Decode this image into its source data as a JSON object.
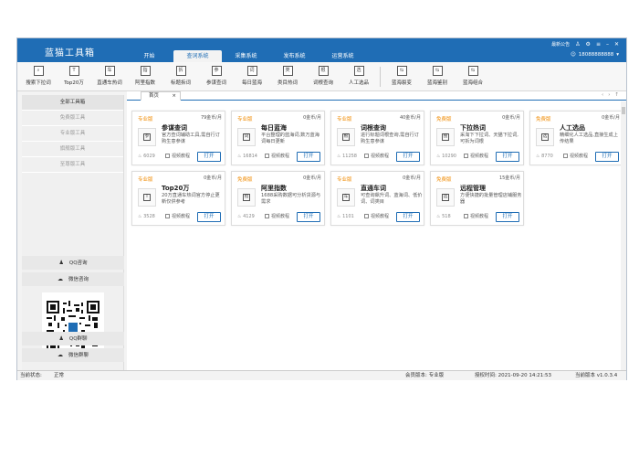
{
  "app": {
    "title": "蓝猫工具箱"
  },
  "nav": {
    "tabs": [
      "开始",
      "查词系统",
      "采集系统",
      "发布系统",
      "运营系统"
    ],
    "active": "查词系统"
  },
  "window": {
    "announcement": "最新公告",
    "user_phone": "18088888888"
  },
  "toolbar": {
    "items": [
      {
        "label": "搜索下拉词",
        "icon": "search-icon"
      },
      {
        "label": "Top20万",
        "icon": "top-icon"
      },
      {
        "label": "直通车热词",
        "icon": "car-icon"
      },
      {
        "label": "阿里指数",
        "icon": "index-icon"
      },
      {
        "label": "标题拆词",
        "icon": "split-icon"
      },
      {
        "label": "参谋查词",
        "icon": "advisor-icon"
      },
      {
        "label": "每日蓝海",
        "icon": "bluesea-icon"
      },
      {
        "label": "类目热词",
        "icon": "category-icon"
      },
      {
        "label": "词根查询",
        "icon": "root-icon"
      },
      {
        "label": "人工选品",
        "icon": "pick-icon"
      },
      {
        "label": "蓝海裂变",
        "icon": "fission-icon"
      },
      {
        "label": "蓝海鉴别",
        "icon": "identify-icon"
      },
      {
        "label": "蓝海组合",
        "icon": "combine-icon"
      }
    ]
  },
  "sidebar": {
    "items": [
      "全部工具箱",
      "免费版工具",
      "专业版工具",
      "旗舰版工具",
      "至尊版工具"
    ],
    "qq_consult": "QQ咨询",
    "wechat_consult": "微信咨询",
    "qq_group": "QQ群聊",
    "wechat_group": "微信群聊"
  },
  "content": {
    "tab_label": "首页",
    "tab_close": "×",
    "tab_nav": {
      "prev": "‹",
      "next": "›",
      "pin": "↑"
    },
    "video_label": "视频教程",
    "open_label": "打开",
    "cards": [
      {
        "tag": "专业版",
        "price": "79金币/月",
        "name": "参谋查词",
        "desc": "官方查词辅助工具,需自行订购生意参谋",
        "heat": "6029",
        "glyph": "参"
      },
      {
        "tag": "专业版",
        "price": "0金币/月",
        "name": "每日蓝海",
        "desc": "平台整理的蓝海词,数万蓝海词每日更新",
        "heat": "16814",
        "glyph": "词"
      },
      {
        "tag": "专业版",
        "price": "40金币/月",
        "name": "词根查询",
        "desc": "进行标题词根查询,需自行订购生意参谋",
        "heat": "11258",
        "glyph": "根"
      },
      {
        "tag": "免费版",
        "price": "0金币/月",
        "name": "下拉热词",
        "desc": "采淘下下拉词、天猫下拉词,可拆为词根",
        "heat": "10290",
        "glyph": "搜"
      },
      {
        "tag": "免费版",
        "price": "0金币/月",
        "name": "人工选品",
        "desc": "精细化人工选品,直接生成上传结果",
        "heat": "8770",
        "glyph": "选"
      },
      {
        "tag": "专业版",
        "price": "0金币/月",
        "name": "Top20万",
        "desc": "20万直通车热词官方停止更新仅供参考",
        "heat": "3528",
        "glyph": "T"
      },
      {
        "tag": "免费版",
        "price": "0金币/月",
        "name": "阿里指数",
        "desc": "1688采购数据可分析货源与需求",
        "heat": "4129",
        "glyph": "指"
      },
      {
        "tag": "专业版",
        "price": "0金币/月",
        "name": "直通车词",
        "desc": "可查询飙升词、蓝海词、低价词、词类目",
        "heat": "1101",
        "glyph": "车"
      },
      {
        "tag": "免费版",
        "price": "15金币/月",
        "name": "远程管理",
        "desc": "方便快捷的批量管理店铺服务器",
        "heat": "518",
        "glyph": "远"
      }
    ]
  },
  "status": {
    "state_label": "当前状态:",
    "state_value": "正常",
    "member": "会员版本: 专业版",
    "auth_time": "授权时间: 2021-09-20 14:21:53",
    "version": "当前版本 v1.0.3.4"
  },
  "colors": {
    "brand": "#1f6db5",
    "tag": "#f08a00"
  }
}
